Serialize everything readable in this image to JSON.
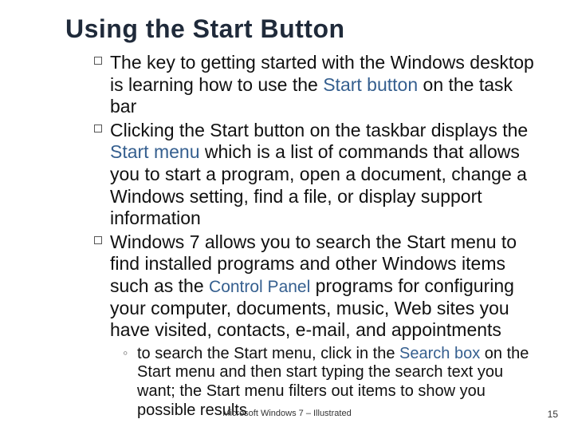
{
  "title": "Using the Start Button",
  "bullets": {
    "b1": {
      "pre": "The key to getting started with the Windows desktop is learning how to use the ",
      "s1": "Start button",
      "post": " on the task bar"
    },
    "b2": {
      "pre": "Clicking the Start button on the taskbar displays the ",
      "s1": "Start menu",
      "post": " which is a list of commands that allows you to start a program, open a document, change a Windows setting, find a file, or display support information"
    },
    "b3": {
      "pre": "Windows 7 allows you to search the Start menu to find installed programs and other Windows items such as the ",
      "s1": "Control Panel",
      "post": " programs for configuring your computer, documents, music, Web sites you have visited, contacts, e-mail, and appointments"
    }
  },
  "sub": {
    "pre": "to search the Start menu, click in the ",
    "s1": "Search box",
    "post": " on the Start menu and then start typing the search text you want; the Start menu filters out items to show you possible results"
  },
  "footer": "Microsoft Windows 7 – Illustrated",
  "page_number": "15"
}
